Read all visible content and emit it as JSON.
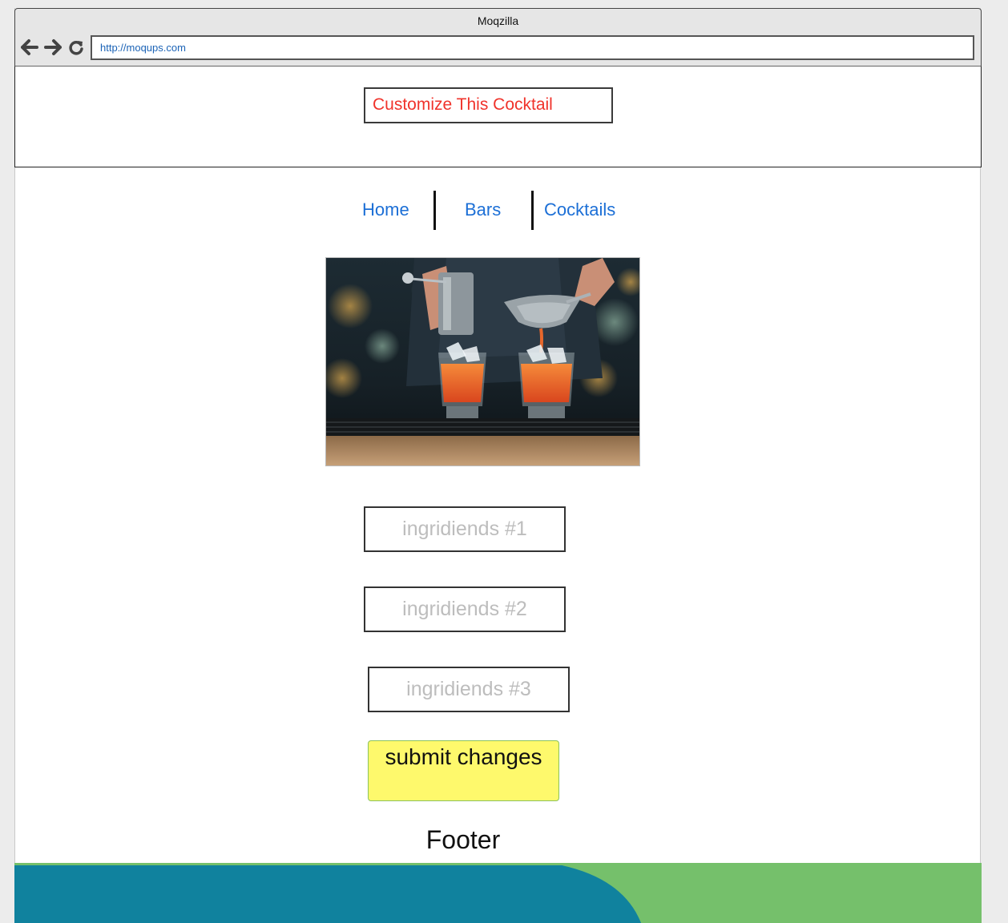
{
  "window": {
    "title": "Moqzilla",
    "url": "http://moqups.com"
  },
  "header": {
    "title": "Customize This Cocktail"
  },
  "nav": {
    "items": [
      "Home",
      "Bars",
      "Cocktails"
    ]
  },
  "form": {
    "fields": [
      {
        "placeholder": "ingridiends #1"
      },
      {
        "placeholder": "ingridiends #2"
      },
      {
        "placeholder": "ingridiends #3"
      }
    ],
    "submit_label": "submit changes"
  },
  "footer": {
    "label": "Footer"
  },
  "colors": {
    "title_text": "#f0332b",
    "nav_link": "#1c6fd6",
    "submit_bg": "#fef96c",
    "footer_teal": "#1380a0",
    "footer_green": "#75c06b"
  }
}
